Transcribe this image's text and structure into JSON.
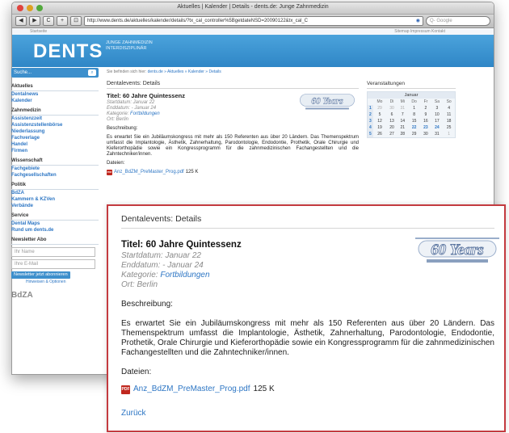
{
  "browser": {
    "window_title": "Aktuelles | Kalender | Details - dents.de: Junge Zahnmedizin",
    "url": "http://www.dents.de/aktuelles/kalender/details/?tx_cal_controller%5BgetdateNSD=20090122&tx_cal_C",
    "search_placeholder": "Q- Google",
    "nav_buttons": [
      "◀",
      "▶",
      "C",
      "+",
      "⊡"
    ]
  },
  "site": {
    "top_left": "Startseite",
    "top_right": "Sitemap   Impressum   Kontakt",
    "logo": "DENTS",
    "tagline": "JUNGE ZAHNMEDIZIN INTERDISZIPLINÄR",
    "search_placeholder": "Suche...",
    "breadcrumb_prefix": "Sie befinden sich hier:",
    "breadcrumb_path": "dents.de » Aktuelles » Kalender » Details"
  },
  "sidebar": {
    "sections": [
      {
        "heading": "Aktuelles",
        "items": [
          "Dentalnews",
          "Kalender"
        ]
      },
      {
        "heading": "Zahnmedizin",
        "items": [
          "Assistenzzeit",
          "Assistenzstellenbörse",
          "Niederlassung",
          "Fachverlage",
          "Handel",
          "Firmen"
        ]
      },
      {
        "heading": "Wissenschaft",
        "items": [
          "Fachgebiete",
          "Fachgesellschaften"
        ]
      },
      {
        "heading": "Politik",
        "items": [
          "BdZA",
          "Kammern & KZVen",
          "Verbände"
        ]
      },
      {
        "heading": "Service",
        "items": [
          "Dental Maps",
          "Rund um dents.de"
        ]
      }
    ],
    "newsletter": {
      "heading": "Newsletter Abo",
      "name_placeholder": "Ihr Name",
      "email_placeholder": "Ihre E-Mail",
      "button": "Newsletter jetzt abonnieren",
      "small_link": "Hinweisen & Optionen"
    },
    "bdza_logo": "BdZA"
  },
  "event": {
    "header": "Dentalevents: Details",
    "title": "Titel: 60 Jahre Quintessenz",
    "start": "Startdatum: Januar 22",
    "end": "Enddatum:  - Januar 24",
    "category_label": "Kategorie:",
    "category_value": "Fortbildungen",
    "location": "Ort: Berlin",
    "description_label": "Beschreibung:",
    "description": "Es erwartet Sie ein Jubiläumskongress mit mehr als 150 Referenten aus über 20 Ländern. Das Themenspektrum umfasst die Implantologie, Ästhetik, Zahnerhaltung, Parodontologie, Endodontie, Prothetik, Orale Chirurgie und Kieferorthopädie sowie ein Kongressprogramm für die zahnmedizinischen Fachangestellten und die Zahntechniker/innen.",
    "files_label": "Dateien:",
    "file_name": "Anz_BdZM_PreMaster_Prog.pdf",
    "file_size": "125 K",
    "back": "Zurück",
    "badge_text": "60 Years"
  },
  "calendar": {
    "heading": "Veranstaltungen",
    "month": "Januar",
    "day_names": [
      "Mo",
      "Di",
      "Mi",
      "Do",
      "Fr",
      "Sa",
      "So"
    ],
    "weeks": [
      {
        "wk": "1",
        "days": [
          "29",
          "30",
          "31",
          "1",
          "2",
          "3",
          "4"
        ]
      },
      {
        "wk": "2",
        "days": [
          "5",
          "6",
          "7",
          "8",
          "9",
          "10",
          "11"
        ]
      },
      {
        "wk": "3",
        "days": [
          "12",
          "13",
          "14",
          "15",
          "16",
          "17",
          "18"
        ]
      },
      {
        "wk": "4",
        "days": [
          "19",
          "20",
          "21",
          "22",
          "23",
          "24",
          "25"
        ]
      },
      {
        "wk": "5",
        "days": [
          "26",
          "27",
          "28",
          "29",
          "30",
          "31",
          "1"
        ]
      }
    ]
  },
  "colors": {
    "brand_blue": "#3d8fcc",
    "link_blue": "#2d76c4",
    "highlight_frame": "#c33a3f"
  }
}
